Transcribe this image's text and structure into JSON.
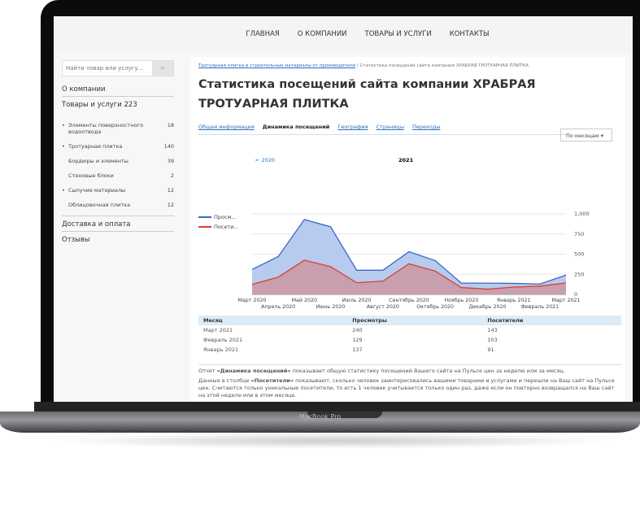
{
  "device": {
    "label": "MacBook Pro"
  },
  "nav": [
    "ГЛАВНАЯ",
    "О КОМПАНИИ",
    "ТОВАРЫ И УСЛУГИ",
    "КОНТАКТЫ"
  ],
  "sidebar": {
    "search_placeholder": "Найти товар или услугу...",
    "about": "О компании",
    "goods": "Товары и услуги 223",
    "items": [
      {
        "label": "Элементы поверхностного водоотвода",
        "count": "18",
        "bullet": true
      },
      {
        "label": "Тротуарная плитка",
        "count": "140",
        "bullet": true
      },
      {
        "label": "Бордюры и элементы",
        "count": "39",
        "bullet": false
      },
      {
        "label": "Стеновые блоки",
        "count": "2",
        "bullet": false
      },
      {
        "label": "Сыпучие материалы",
        "count": "12",
        "bullet": true
      },
      {
        "label": "Облицовочная плитка",
        "count": "12",
        "bullet": false
      }
    ],
    "delivery": "Доставка и оплата",
    "reviews": "Отзывы"
  },
  "breadcrumb": {
    "link": "Тротуарная плитка и строительные материалы от производителя",
    "sep": "/",
    "current": "Статистика посещений сайта компании ХРАБРАЯ ТРОТУАРНАЯ ПЛИТКА"
  },
  "title": "Статистика посещений сайта компании ХРАБРАЯ ТРОТУАРНАЯ ПЛИТКА",
  "tabs": [
    "Общая информация",
    "Динамика посещений",
    "География",
    "Страницы",
    "Переходы"
  ],
  "active_tab": "Динамика посещений",
  "period_select": "По месяцам ▾",
  "prev_year": "← 2020",
  "current_year": "2021",
  "chart_data": {
    "type": "area",
    "x": [
      "Март 2020",
      "Апрель 2020",
      "Май 2020",
      "Июнь 2020",
      "Июль 2020",
      "Август 2020",
      "Сентябрь 2020",
      "Октябрь 2020",
      "Ноябрь 2020",
      "Декабрь 2020",
      "Январь 2021",
      "Февраль 2021",
      "Март 2021"
    ],
    "series": [
      {
        "name": "Просм...",
        "color": "#3b67c4",
        "fill": "#b7cbef",
        "values": [
          310,
          470,
          930,
          840,
          300,
          300,
          530,
          420,
          140,
          140,
          137,
          129,
          240
        ]
      },
      {
        "name": "Посети...",
        "color": "#d9412f",
        "fill": "#c99aa6",
        "values": [
          125,
          215,
          425,
          345,
          145,
          165,
          380,
          290,
          85,
          65,
          91,
          103,
          143
        ]
      }
    ],
    "yticks": [
      "0",
      "250",
      "500",
      "750",
      "1,000"
    ],
    "ylim": [
      0,
      1000
    ],
    "grid": true,
    "legend": "left"
  },
  "table": {
    "headers": [
      "Месяц",
      "Просмотры",
      "Посетители"
    ],
    "rows": [
      [
        "Март 2021",
        "240",
        "143"
      ],
      [
        "Февраль 2021",
        "129",
        "103"
      ],
      [
        "Январь 2021",
        "137",
        "91"
      ]
    ]
  },
  "note1": {
    "pre": "Отчет ",
    "bold": "«Динамика посещений»",
    "post": " показывает общую статистику посещений Вашего сайта на Пульсе цен за неделю или за месяц."
  },
  "note2": {
    "pre": "Данные в столбце ",
    "bold": "«Посетители»",
    "post": " показывают, сколько человек заинтересовались вашими товарами и услугами и перешли на Ваш сайт на Пульсе цен. Считаются только уникальные посетители, то есть 1 человек учитывается только один раз, даже если он повторно возвращался на Ваш сайт на этой неделе или в этом месяце."
  }
}
